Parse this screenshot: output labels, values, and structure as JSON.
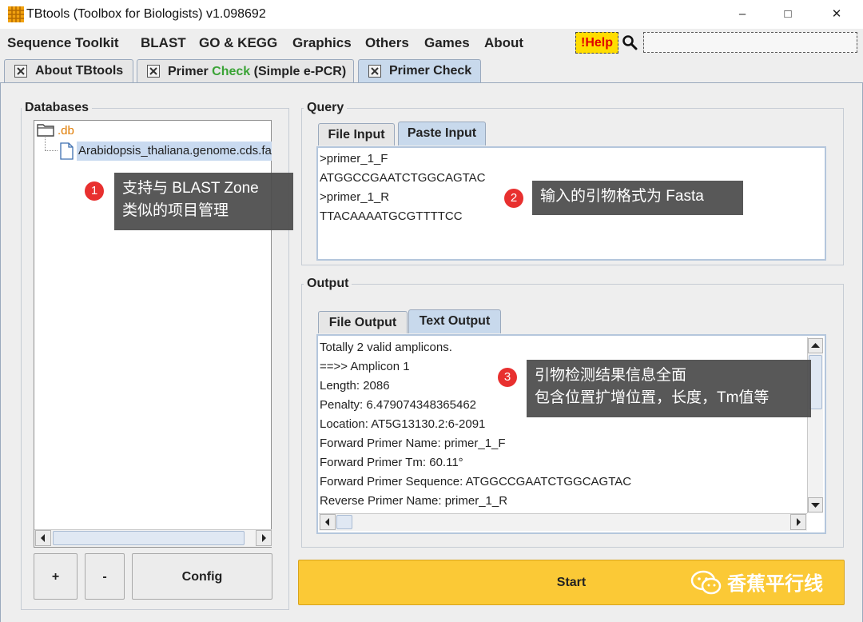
{
  "window": {
    "title": "TBtools (Toolbox for Biologists) v1.098692",
    "controls": {
      "minimize": "–",
      "maximize": "□",
      "close": "✕"
    }
  },
  "menu": {
    "items": [
      "Sequence Toolkit",
      "BLAST",
      "GO & KEGG",
      "Graphics",
      "Others",
      "Games",
      "About"
    ],
    "help_label": "!Help",
    "search_value": ""
  },
  "tabs": [
    {
      "label": "About TBtools",
      "active": false
    },
    {
      "label_prefix": "Primer ",
      "label_green": "Check",
      "label_suffix": " (Simple e-PCR)",
      "active": false
    },
    {
      "label": "Primer Check",
      "active": true
    }
  ],
  "databases": {
    "title": "Databases",
    "root": ".db",
    "file": "Arabidopsis_thaliana.genome.cds.fa",
    "buttons": {
      "add": "+",
      "remove": "-",
      "config": "Config"
    }
  },
  "query": {
    "title": "Query",
    "tabs": [
      "File Input",
      "Paste Input"
    ],
    "active_tab": "Paste Input",
    "lines": [
      ">primer_1_F",
      "ATGGCCGAATCTGGCAGTAC",
      ">primer_1_R",
      "TTACAAAATGCGTTTTCC"
    ]
  },
  "output": {
    "title": "Output",
    "tabs": [
      "File Output",
      "Text Output"
    ],
    "active_tab": "Text Output",
    "lines": [
      "Totally 2  valid amplicons.",
      "==>> Amplicon 1",
      "Length: 2086",
      "Penalty: 6.479074348365462",
      "Location: AT5G13130.2:6-2091",
      "Forward Primer Name: primer_1_F",
      "Forward Primer Tm: 60.11°",
      "Forward Primer Sequence: ATGGCCGAATCTGGCAGTAC",
      "Reverse Primer Name: primer_1_R"
    ]
  },
  "start_label": "Start",
  "annotations": [
    {
      "num": "1",
      "lines": [
        "支持与 BLAST Zone",
        "类似的项目管理"
      ]
    },
    {
      "num": "2",
      "lines": [
        "输入的引物格式为 Fasta"
      ]
    },
    {
      "num": "3",
      "lines": [
        "引物检测结果信息全面",
        "包含位置扩增位置，长度，Tm值等"
      ]
    }
  ],
  "watermark": "香蕉平行线",
  "colors": {
    "accent_start": "#fbc936",
    "help_bg": "#ffdd00",
    "help_text": "#e00000",
    "tab_active": "#c8d9ec",
    "green_text": "#3aa335",
    "folder_label": "#e07b00",
    "callout_badge": "#e8302f"
  },
  "icons": [
    "app-grid-icon",
    "search-icon",
    "close-tab-icon",
    "folder-icon",
    "file-icon",
    "wechat-icon"
  ]
}
